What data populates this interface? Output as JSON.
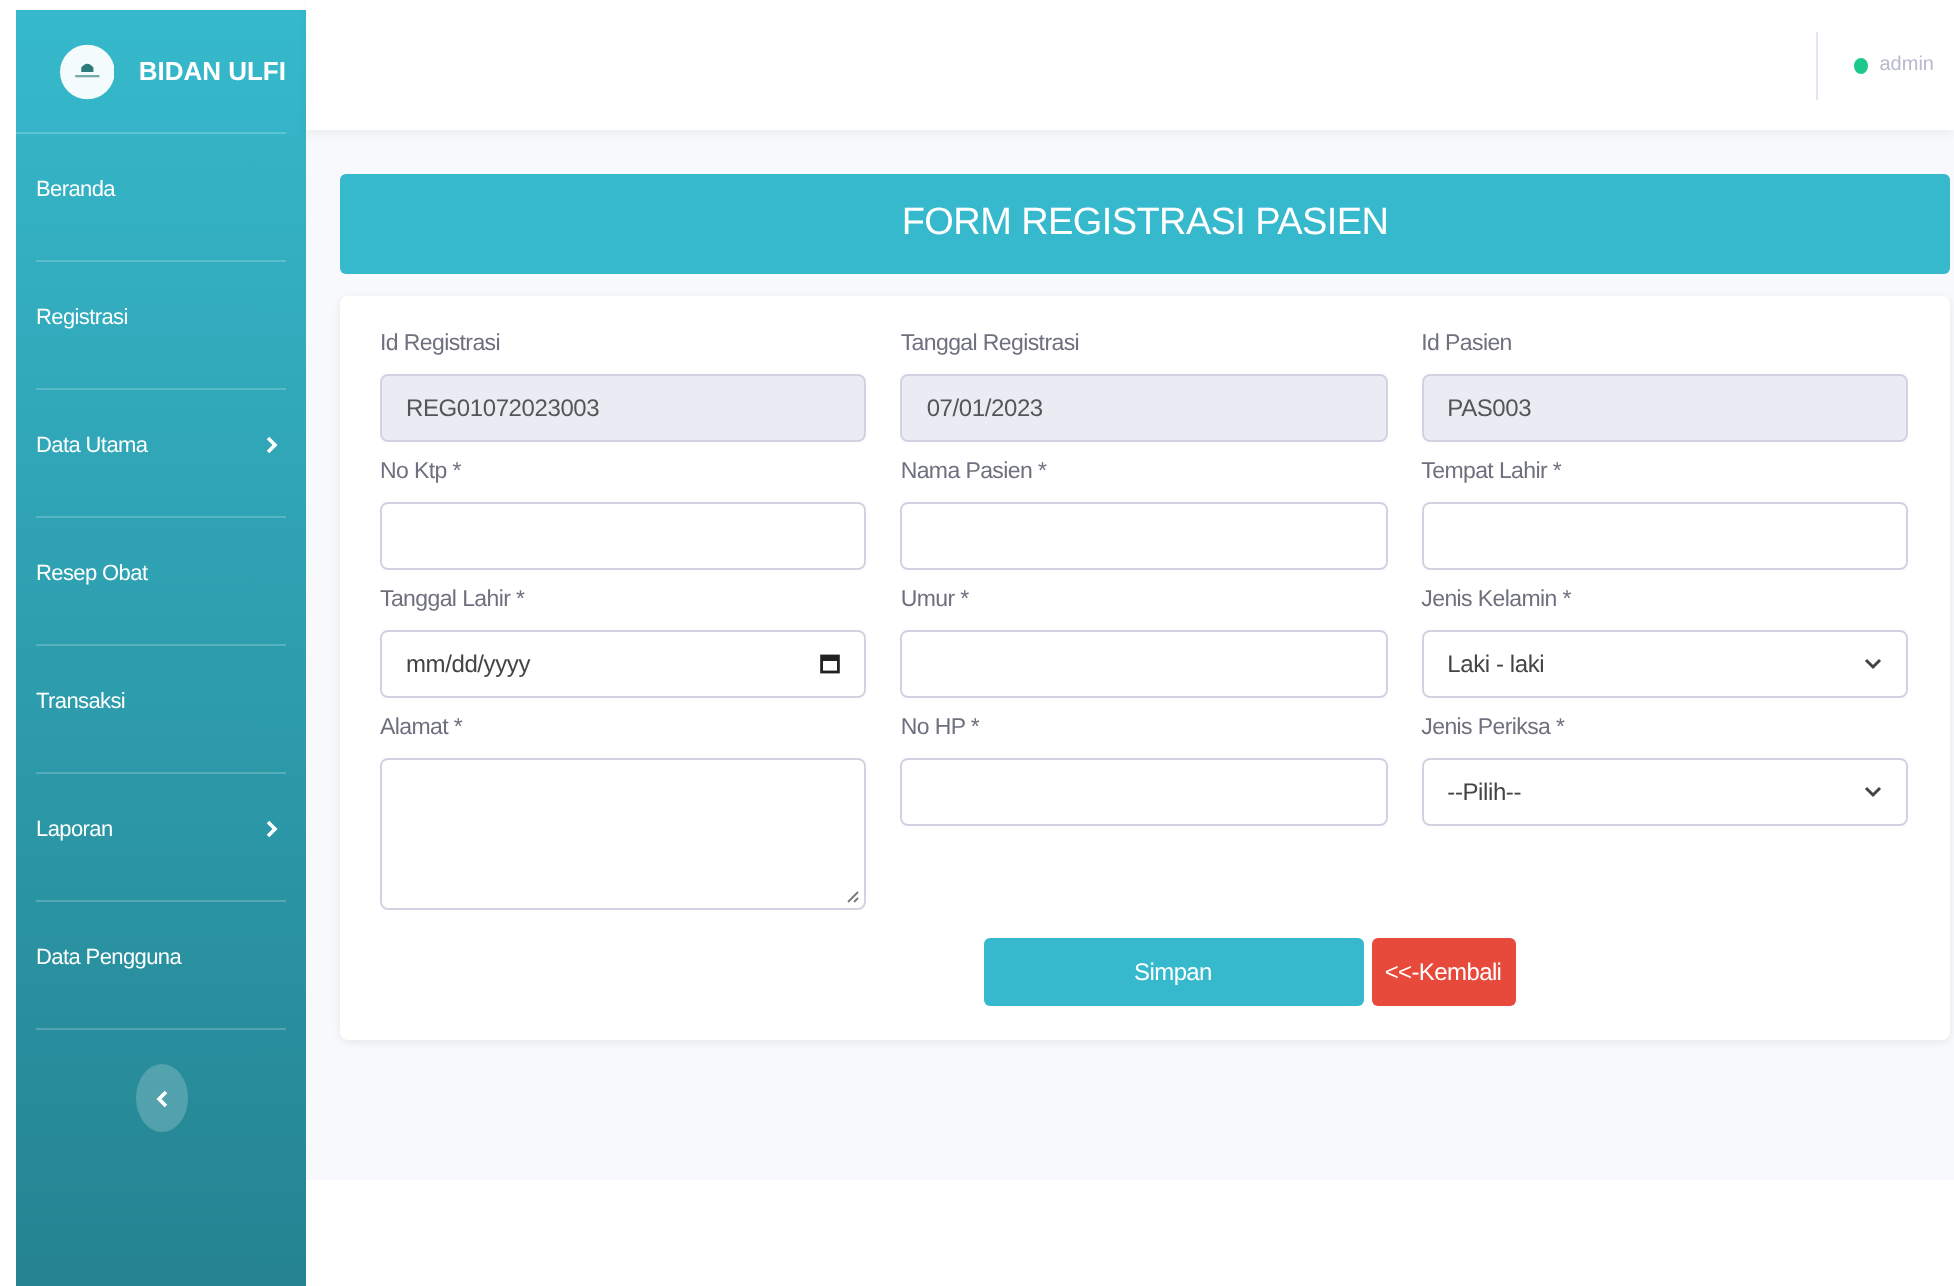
{
  "brand": {
    "name": "BIDAN ULFI"
  },
  "sidebar": {
    "items": [
      {
        "label": "Beranda",
        "has_submenu": false
      },
      {
        "label": "Registrasi",
        "has_submenu": false
      },
      {
        "label": "Data Utama",
        "has_submenu": true
      },
      {
        "label": "Resep Obat",
        "has_submenu": false
      },
      {
        "label": "Transaksi",
        "has_submenu": false
      },
      {
        "label": "Laporan",
        "has_submenu": true
      },
      {
        "label": "Data Pengguna",
        "has_submenu": false
      }
    ]
  },
  "topbar": {
    "user": "admin"
  },
  "form": {
    "title": "FORM REGISTRASI PASIEN",
    "fields": [
      {
        "label": "Id Registrasi",
        "kind": "text",
        "value": "REG01072023003",
        "readonly": true
      },
      {
        "label": "Tanggal Registrasi",
        "kind": "text",
        "value": "07/01/2023",
        "readonly": true
      },
      {
        "label": "Id Pasien",
        "kind": "text",
        "value": "PAS003",
        "readonly": true
      },
      {
        "label": "No Ktp *",
        "kind": "text",
        "readonly": false
      },
      {
        "label": "Nama Pasien *",
        "kind": "text",
        "readonly": false
      },
      {
        "label": "Tempat Lahir *",
        "kind": "text",
        "readonly": false
      },
      {
        "label": "Tanggal Lahir *",
        "kind": "date",
        "placeholder": "mm/dd/yyyy",
        "readonly": false
      },
      {
        "label": "Umur *",
        "kind": "text",
        "readonly": false
      },
      {
        "label": "Jenis Kelamin *",
        "kind": "select",
        "value": "Laki - laki",
        "readonly": false
      },
      {
        "label": "Alamat *",
        "kind": "textarea",
        "readonly": false
      },
      {
        "label": "No HP *",
        "kind": "text",
        "readonly": false
      },
      {
        "label": "Jenis Periksa *",
        "kind": "select",
        "value": "--Pilih--",
        "readonly": false
      }
    ],
    "buttons": [
      {
        "label": "Simpan",
        "kind": "primary"
      },
      {
        "label": "<<-Kembali",
        "kind": "danger"
      }
    ]
  }
}
